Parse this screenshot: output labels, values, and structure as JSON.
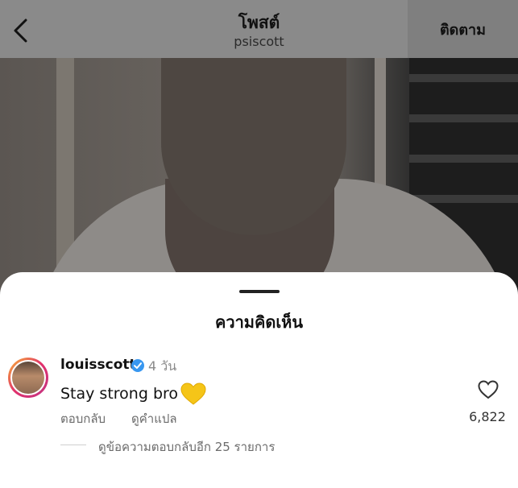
{
  "header": {
    "title": "โพสต์",
    "subtitle": "psiscott",
    "follow_label": "ติดตาม"
  },
  "icons": {
    "back": "chevron-left-icon",
    "verified": "verified-badge-icon",
    "like": "heart-outline-icon",
    "emoji": "yellow-heart-emoji"
  },
  "colors": {
    "verified": "#3897f0",
    "emoji_heart": "#f5c518"
  },
  "sheet": {
    "title": "ความคิดเห็น",
    "comment": {
      "username": "louisscott",
      "time": "4 วัน",
      "text": "Stay strong bro",
      "reply_label": "ตอบกลับ",
      "translate_label": "ดูคำแปล",
      "likes": "6,822",
      "view_replies": "ดูข้อความตอบกลับอีก 25 รายการ"
    }
  }
}
